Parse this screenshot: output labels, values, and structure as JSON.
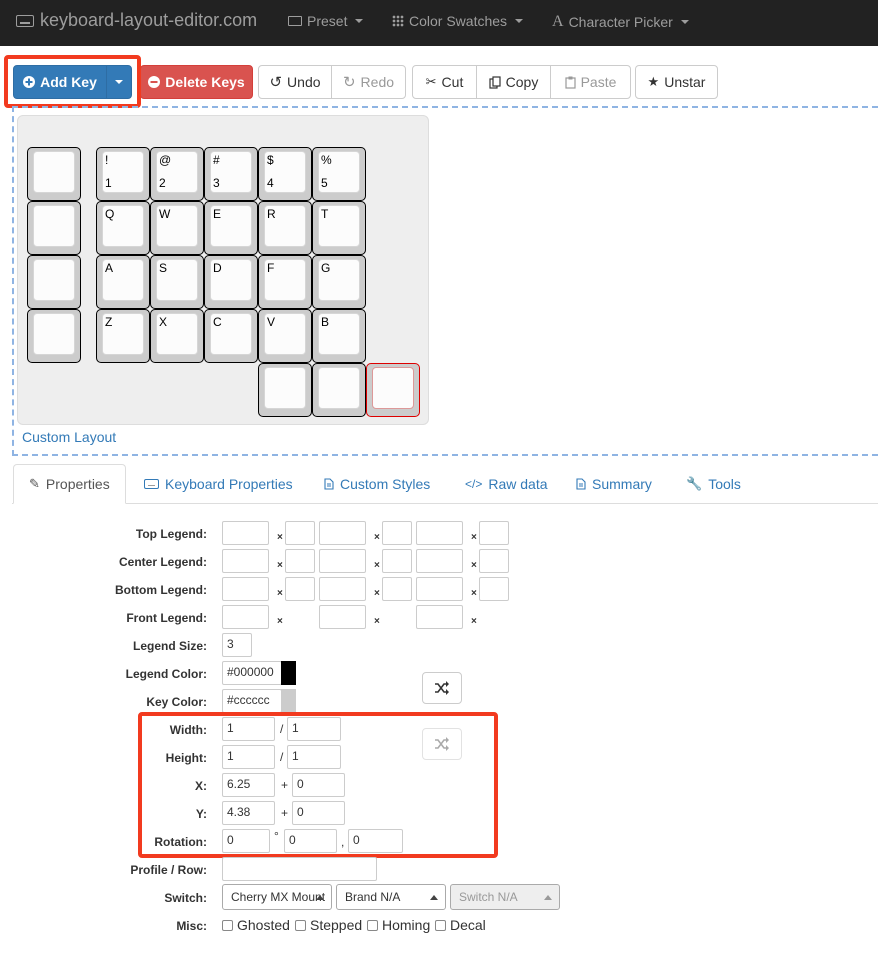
{
  "navbar": {
    "brand": "keyboard-layout-editor.com",
    "menus": [
      "Preset",
      "Color Swatches",
      "Character Picker"
    ]
  },
  "toolbar": {
    "add_key": "Add Key",
    "delete_keys": "Delete Keys",
    "undo": "Undo",
    "redo": "Redo",
    "cut": "Cut",
    "copy": "Copy",
    "paste": "Paste",
    "unstar": "Unstar"
  },
  "layout_name": "Custom Layout",
  "keys": [
    {
      "top": "",
      "bottom": ""
    },
    {
      "top": "!",
      "bottom": "1"
    },
    {
      "top": "@",
      "bottom": "2"
    },
    {
      "top": "#",
      "bottom": "3"
    },
    {
      "top": "$",
      "bottom": "4"
    },
    {
      "top": "%",
      "bottom": "5"
    },
    {
      "top": "",
      "bottom": ""
    },
    {
      "top": "Q",
      "bottom": ""
    },
    {
      "top": "W",
      "bottom": ""
    },
    {
      "top": "E",
      "bottom": ""
    },
    {
      "top": "R",
      "bottom": ""
    },
    {
      "top": "T",
      "bottom": ""
    },
    {
      "top": "",
      "bottom": ""
    },
    {
      "top": "A",
      "bottom": ""
    },
    {
      "top": "S",
      "bottom": ""
    },
    {
      "top": "D",
      "bottom": ""
    },
    {
      "top": "F",
      "bottom": ""
    },
    {
      "top": "G",
      "bottom": ""
    },
    {
      "top": "",
      "bottom": ""
    },
    {
      "top": "Z",
      "bottom": ""
    },
    {
      "top": "X",
      "bottom": ""
    },
    {
      "top": "C",
      "bottom": ""
    },
    {
      "top": "V",
      "bottom": ""
    },
    {
      "top": "B",
      "bottom": ""
    },
    {
      "top": "",
      "bottom": ""
    },
    {
      "top": "",
      "bottom": ""
    },
    {
      "top": "",
      "bottom": ""
    }
  ],
  "tabs": [
    "Properties",
    "Keyboard Properties",
    "Custom Styles",
    "Raw data",
    "Summary",
    "Tools"
  ],
  "form": {
    "labels": {
      "top_legend": "Top Legend:",
      "center_legend": "Center Legend:",
      "bottom_legend": "Bottom Legend:",
      "front_legend": "Front Legend:",
      "legend_size": "Legend Size:",
      "legend_color": "Legend Color:",
      "key_color": "Key Color:",
      "width": "Width:",
      "height": "Height:",
      "x": "X:",
      "y": "Y:",
      "rotation": "Rotation:",
      "profile_row": "Profile / Row:",
      "switch": "Switch:",
      "misc": "Misc:"
    },
    "x_mark": "×",
    "legend_size": "3",
    "legend_color": "#000000",
    "key_color": "#cccccc",
    "legend_color_swatch": "#000000",
    "key_color_swatch": "#cccccc",
    "width": "1",
    "width2": "1",
    "height": "1",
    "height2": "1",
    "x": "6.25",
    "x_offset": "0",
    "y": "4.38",
    "y_offset": "0",
    "rotation": "0",
    "rotation_x": "0",
    "rotation_y": "0",
    "profile_row": "",
    "switch_mount": "Cherry MX Mount",
    "switch_brand": "Brand N/A",
    "switch_type": "Switch N/A",
    "misc": [
      "Ghosted",
      "Stepped",
      "Homing",
      "Decal"
    ],
    "sep_slash": "/",
    "sep_plus": "+",
    "sep_deg": "°",
    "sep_comma": ","
  },
  "colors": {
    "primary": "#337ab7",
    "danger": "#d9534f",
    "highlight": "#f23a1f"
  }
}
